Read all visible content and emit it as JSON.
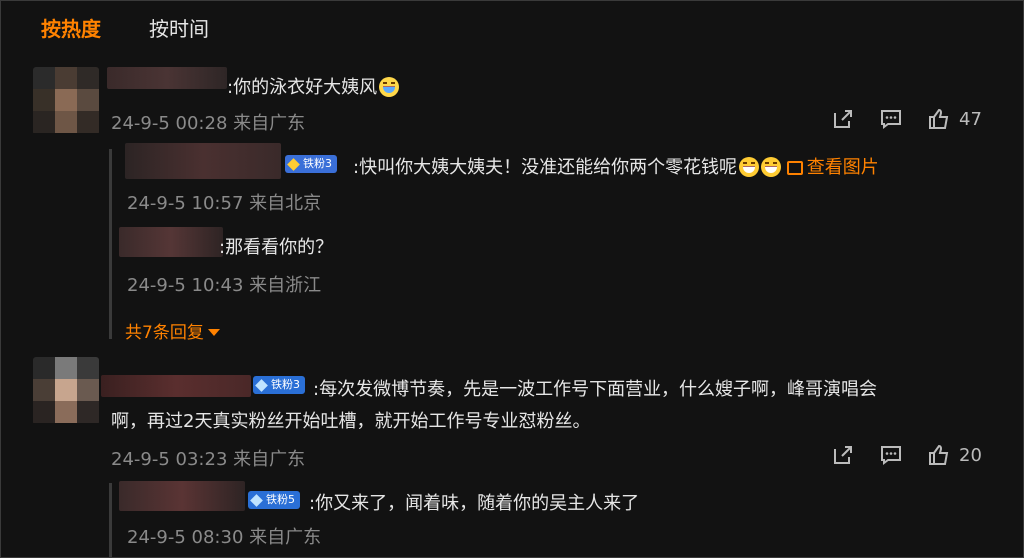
{
  "tabs": {
    "hot": "按热度",
    "time": "按时间"
  },
  "comments": [
    {
      "text": ":你的泳衣好大姨风",
      "meta": "24-9-5 00:28 来自广东",
      "likes": "47",
      "replies": [
        {
          "badge": "铁粉3",
          "text": ":快叫你大姨大姨夫！没准还能给你两个零花钱呢",
          "view_image": "查看图片",
          "meta": "24-9-5 10:57 来自北京"
        },
        {
          "text": ":那看看你的？",
          "meta": "24-9-5 10:43 来自浙江"
        }
      ],
      "more_replies": "共7条回复"
    },
    {
      "badge": "铁粉3",
      "text_line1": ":每次发微博节奏，先是一波工作号下面营业，什么嫂子啊，峰哥演唱会",
      "text_line2": "啊，再过2天真实粉丝开始吐槽，就开始工作号专业怼粉丝。",
      "meta": "24-9-5 03:23 来自广东",
      "likes": "20",
      "replies": [
        {
          "badge": "铁粉5",
          "text": ":你又来了，闻着味，随着你的吴主人来了",
          "meta": "24-9-5 08:30 来自广东"
        }
      ]
    }
  ],
  "icons": [
    "share-icon",
    "comment-icon",
    "like-icon",
    "image-icon",
    "laugh-emoji",
    "grin-emoji"
  ],
  "colors": {
    "accent": "#ff8200",
    "background": "#121212",
    "badge": "#2a6fd6"
  }
}
